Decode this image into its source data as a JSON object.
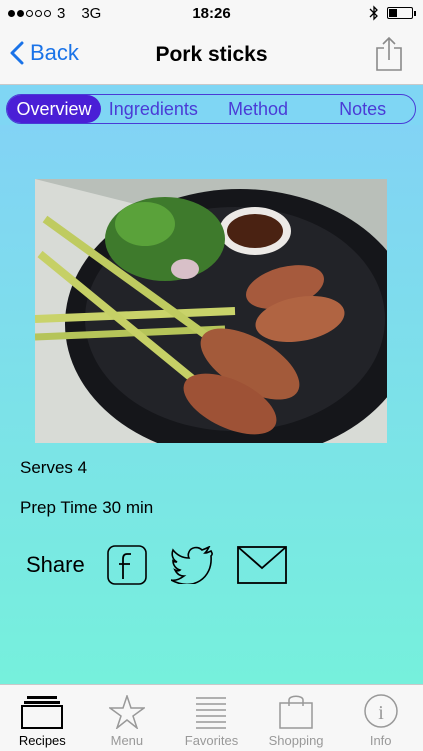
{
  "status_bar": {
    "carrier": "3",
    "network": "3G",
    "time": "18:26",
    "battery_level": 0.35
  },
  "nav": {
    "back_label": "Back",
    "title": "Pork sticks",
    "share_icon": "share-icon"
  },
  "segments": [
    {
      "label": "Overview",
      "active": true
    },
    {
      "label": "Ingredients",
      "active": false
    },
    {
      "label": "Method",
      "active": false
    },
    {
      "label": "Notes",
      "active": false
    }
  ],
  "recipe": {
    "serves": "Serves 4",
    "prep_time": "Prep Time 30 min",
    "share_label": "Share"
  },
  "tabbar": [
    {
      "label": "Recipes",
      "icon": "recipes-icon",
      "active": true
    },
    {
      "label": "Menu",
      "icon": "star-icon",
      "active": false
    },
    {
      "label": "Favorites",
      "icon": "list-icon",
      "active": false
    },
    {
      "label": "Shopping",
      "icon": "bag-icon",
      "active": false
    },
    {
      "label": "Info",
      "icon": "info-icon",
      "active": false
    }
  ],
  "colors": {
    "accent": "#4a1fd6",
    "back": "#1a73e8",
    "bg_top": "#82d3f5",
    "bg_bottom": "#76f0dc"
  }
}
